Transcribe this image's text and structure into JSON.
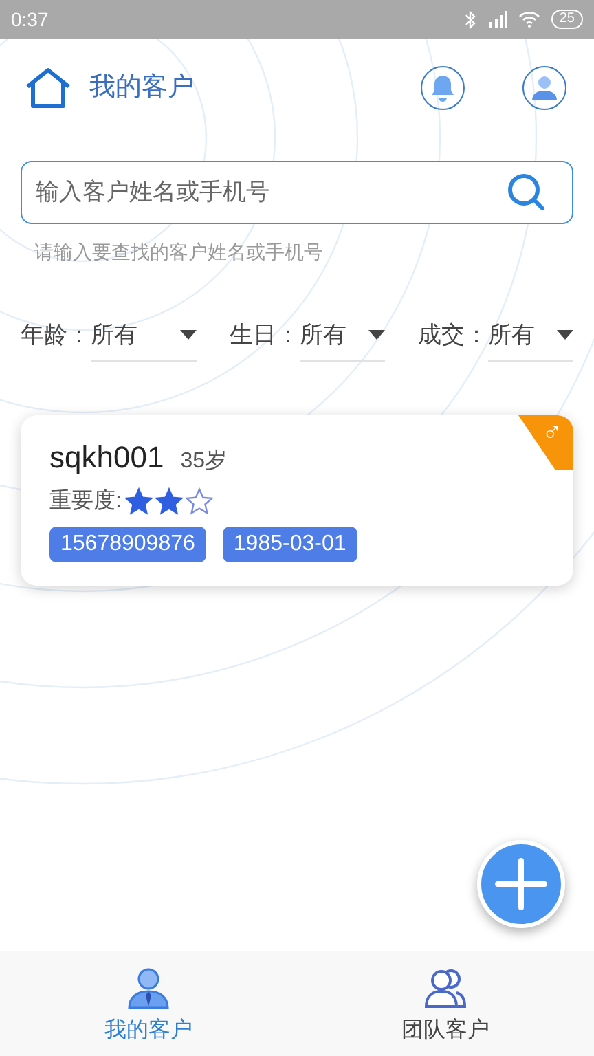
{
  "status_bar": {
    "time": "0:37",
    "battery": "25"
  },
  "header": {
    "title": "我的客户"
  },
  "search": {
    "placeholder": "输入客户姓名或手机号",
    "hint": "请输入要查找的客户姓名或手机号"
  },
  "filters": [
    {
      "label": "年龄：",
      "value": "所有"
    },
    {
      "label": "生日：",
      "value": "所有"
    },
    {
      "label": "成交：",
      "value": "所有"
    }
  ],
  "customers": [
    {
      "name": "sqkh001",
      "age": "35岁",
      "importance_label": "重要度:",
      "stars": 2,
      "gender_mark": "♂",
      "tags": [
        "15678909876",
        "1985-03-01"
      ]
    }
  ],
  "bottom_nav": [
    {
      "label": "我的客户",
      "kind": "single",
      "selected": true
    },
    {
      "label": "团队客户",
      "kind": "team",
      "selected": false
    }
  ]
}
